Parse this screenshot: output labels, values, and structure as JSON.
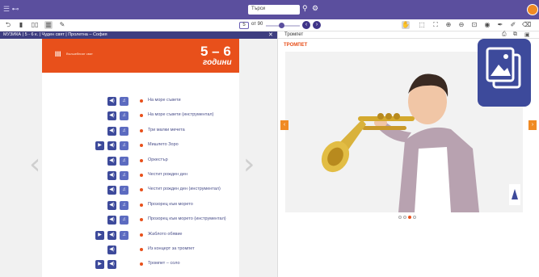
{
  "topbar": {
    "search_placeholder": "Търси"
  },
  "toolbar": {
    "page_current": "5",
    "page_total": "от 90"
  },
  "book": {
    "breadcrumb": "МУЗИКА | 5 - 6 к. | Чуден свят | Пролетна – София",
    "close_label": "✕",
    "unit_roman": "III",
    "unit_subtitle": "Вълшебният свят",
    "grade_range": "5 – 6",
    "grade_word": "години",
    "tracks": [
      {
        "label": "На море съвети",
        "buttons": [
          "audio",
          "note"
        ]
      },
      {
        "label": "На море съвети (инструментал)",
        "buttons": [
          "audio",
          "note"
        ]
      },
      {
        "label": "Три малки мечета",
        "buttons": [
          "audio",
          "note"
        ]
      },
      {
        "label": "Мишлето Зоро",
        "buttons": [
          "play",
          "audio",
          "note"
        ]
      },
      {
        "label": "Оркестър",
        "buttons": [
          "audio",
          "note"
        ]
      },
      {
        "label": "Честит рожден ден",
        "buttons": [
          "audio",
          "note"
        ]
      },
      {
        "label": "Честит рожден ден (инструментал)",
        "buttons": [
          "audio",
          "note"
        ]
      },
      {
        "label": "Прозорец към морето",
        "buttons": [
          "audio",
          "note"
        ]
      },
      {
        "label": "Прозорец към морето (инструментал)",
        "buttons": [
          "audio",
          "note"
        ]
      },
      {
        "label": "Жаблото обявие",
        "buttons": [
          "play",
          "audio",
          "note"
        ]
      },
      {
        "label": "Из концерт за тромпет",
        "buttons": [
          "audio"
        ]
      },
      {
        "label": "Тромпет – соло",
        "buttons": [
          "play",
          "audio"
        ]
      }
    ]
  },
  "media": {
    "header_title": "Тромпет",
    "caption": "ТРОМПЕТ",
    "slide_count": 4,
    "active_slide": 2
  },
  "colors": {
    "brand": "#5b4f9e",
    "accent": "#e8501b",
    "button": "#3d4a9b"
  }
}
